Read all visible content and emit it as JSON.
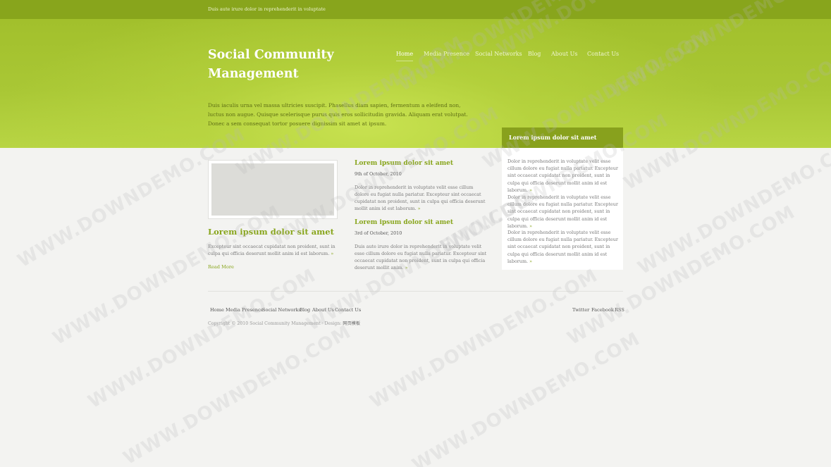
{
  "topbar": {
    "text": "Duis aute irure dolor in reprehenderit in voluptate"
  },
  "header": {
    "site_title": "Social Community Management",
    "intro": "Duis iaculis urna vel massa ultricies suscipit. Phasellus diam sapien, fermentum a eleifend non, luctus non augue. Quisque scelerisque purus quis eros sollicitudin gravida. Aliquam erat volutpat. Donec a sem consequat tortor posuere dignissim sit amet at ipsum."
  },
  "nav": {
    "items": [
      {
        "label": "Home",
        "active": true
      },
      {
        "label": "Media Presence"
      },
      {
        "label": "Social Networks"
      },
      {
        "label": "Blog"
      },
      {
        "label": "About Us"
      },
      {
        "label": "Contact Us"
      }
    ]
  },
  "sidebar": {
    "title": "Lorem ipsum dolor sit amet",
    "paragraphs": [
      "Dolor in reprehenderit in voluptate velit esse cillum dolore eu fugiat nulla pariatur. Excepteur sint occaecat cupidatat non proident, sunt in culpa qui officia deserunt mollit anim id est laborum.",
      "Dolor in reprehenderit in voluptate velit esse cillum dolore eu fugiat nulla pariatur. Excepteur sint occaecat cupidatat non proident, sunt in culpa qui officia deserunt mollit anim id est laborum.",
      "Dolor in reprehenderit in voluptate velit esse cillum dolore eu fugiat nulla pariatur. Excepteur sint occaecat cupidatat non proident, sunt in culpa qui officia deserunt mollit anim id est laborum."
    ],
    "arrow": "»"
  },
  "feature": {
    "title": "Lorem ipsum dolor sit amet",
    "text": "Excepteur sint occaecat cupidatat non proident, sunt in culpa qui officia deserunt mollit anim id est laborum.",
    "read_more": "Read More"
  },
  "posts": [
    {
      "title": "Lorem ipsum dolor sit amet",
      "date": "9th of October, 2010",
      "text": "Dolor in reprehenderit in voluptate velit esse cillum dolore eu fugiat nulla pariatur. Excepteur sint occaecat cupidatat non proident, sunt in culpa qui officia deserunt mollit anim id est laborum."
    },
    {
      "title": "Lorem ipsum dolor sit amet",
      "date": "3rd of October, 2010",
      "text": "Duis aute irure dolor in reprehenderit in voluptate velit esse cillum dolore eu fugiat nulla pariatur. Excepteur sint occaecat cupidatat non proident, sunt in culpa qui officia deserunt mollit anim."
    }
  ],
  "footer": {
    "nav": [
      "Home",
      "Media Presence",
      "Social Networks",
      "Blog",
      "About Us",
      "Contact Us"
    ],
    "social": [
      "Twitter",
      "Facebook",
      "RSS"
    ],
    "copyright": "Copyright © 2010 Social Community Management · Design:",
    "designer": "网页模板"
  },
  "watermark": "WWW.DOWNDEMO.COM",
  "colors": {
    "accent": "#88a51c",
    "hero": "#a9c735",
    "background": "#f3f3f1"
  }
}
